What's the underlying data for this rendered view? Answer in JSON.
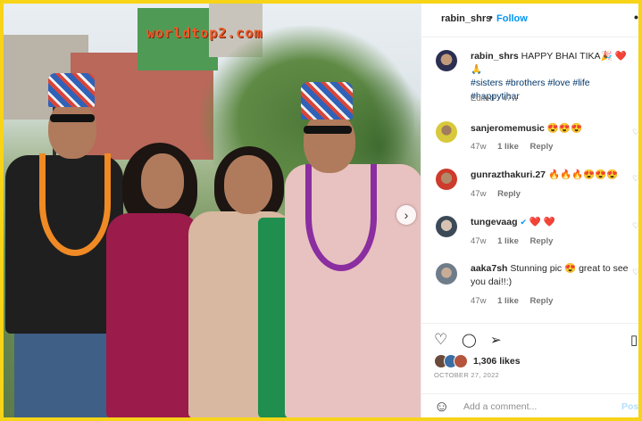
{
  "photo": {
    "watermark": "worldtop2.com",
    "next_icon": "›"
  },
  "header": {
    "username": "rabin_shrs",
    "separator": "•",
    "follow_label": "Follow",
    "more_icon": "•••"
  },
  "caption": {
    "username": "rabin_shrs",
    "text": " HAPPY BHAI TIKA🎉 ❤️ 🙏",
    "hashtags": "#sisters #brothers #love #life #happytihar",
    "edited": "Edited · 47w"
  },
  "comments": [
    {
      "username": "sanjeromemusic",
      "text": " 😍😍😍",
      "age": "47w",
      "likes": "1 like",
      "reply": "Reply"
    },
    {
      "username": "gunrazthakuri.27",
      "text": " 🔥🔥🔥😍😍😍",
      "age": "47w",
      "likes": "",
      "reply": "Reply"
    },
    {
      "username": "tungevaag",
      "verified": "✔",
      "text": " ❤️ ❤️",
      "age": "47w",
      "likes": "1 like",
      "reply": "Reply"
    },
    {
      "username": "aaka7sh",
      "text": " Stunning pic 😍 great to see you dai!!:)",
      "age": "47w",
      "likes": "1 like",
      "reply": "Reply"
    }
  ],
  "actions": {
    "like_icon": "♡",
    "comment_icon": "◯",
    "share_icon": "➢",
    "save_icon": "▯",
    "likes": "1,306 likes",
    "date": "OCTOBER 27, 2022"
  },
  "add_comment": {
    "emoji_icon": "☺",
    "placeholder": "Add a comment...",
    "post_label": "Post"
  }
}
